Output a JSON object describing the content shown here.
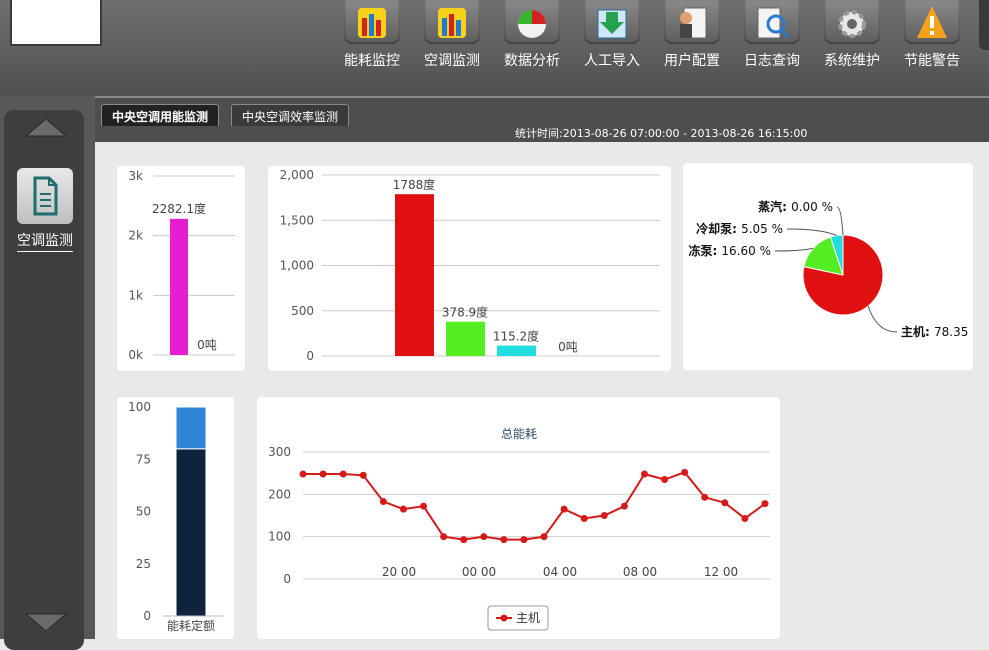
{
  "nav": {
    "items": [
      {
        "label": "能耗监控",
        "icon": "energy-monitor-chart-icon"
      },
      {
        "label": "空调监测",
        "icon": "ac-monitor-chart-icon"
      },
      {
        "label": "数据分析",
        "icon": "pie-analysis-icon"
      },
      {
        "label": "人工导入",
        "icon": "import-arrow-icon"
      },
      {
        "label": "用户配置",
        "icon": "user-config-icon"
      },
      {
        "label": "日志查询",
        "icon": "log-search-icon"
      },
      {
        "label": "系统维护",
        "icon": "gear-icon"
      },
      {
        "label": "节能警告",
        "icon": "warning-icon"
      }
    ]
  },
  "sidebar": {
    "item_label": "空调监测"
  },
  "tabs": [
    {
      "label": "中央空调用能监测",
      "active": true
    },
    {
      "label": "中央空调效率监测",
      "active": false
    }
  ],
  "stat_time": "统计时间:2013-08-26 07:00:00 - 2013-08-26 16:15:00",
  "chart_data": [
    {
      "type": "bar",
      "categories": [
        "",
        ""
      ],
      "values": [
        2282.1,
        0
      ],
      "value_labels": [
        "2282.1度",
        "0吨"
      ],
      "colors": [
        "#e61ed2",
        "#e61ed2"
      ],
      "yticks": [
        "0k",
        "1k",
        "2k",
        "3k"
      ],
      "ylim": [
        0,
        3000
      ]
    },
    {
      "type": "bar",
      "categories": [
        "",
        "",
        "",
        ""
      ],
      "values": [
        1788,
        378.9,
        115.2,
        0
      ],
      "value_labels": [
        "1788度",
        "378.9度",
        "115.2度",
        "0吨"
      ],
      "colors": [
        "#e01010",
        "#55ee22",
        "#22dde0",
        "#2060ff"
      ],
      "yticks": [
        "0",
        "500",
        "1,000",
        "1,500",
        "2,000"
      ],
      "ylim": [
        0,
        2000
      ]
    },
    {
      "type": "pie",
      "slices": [
        {
          "name": "主机",
          "value": 78.35,
          "label": "78.35",
          "color": "#e01010"
        },
        {
          "name": "冷冻泵",
          "value": 16.6,
          "label": "16.60 %",
          "visible_name": "冻泵",
          "color": "#55ee22"
        },
        {
          "name": "冷却泵",
          "value": 5.05,
          "label": "5.05 %",
          "color": "#22dde0"
        },
        {
          "name": "蒸汽",
          "value": 0.0,
          "label": "0.00 %",
          "color": "#2060ff"
        }
      ]
    },
    {
      "type": "bar",
      "stacked": true,
      "categories": [
        "能耗定额"
      ],
      "series": [
        {
          "values": [
            80
          ],
          "color": "#10233c"
        },
        {
          "values": [
            20
          ],
          "color": "#2f86d8"
        }
      ],
      "yticks": [
        "0",
        "25",
        "50",
        "75",
        "100"
      ],
      "ylim": [
        0,
        100
      ]
    },
    {
      "type": "line",
      "title": "总能耗",
      "xticks": [
        "20 00",
        "00 00",
        "04 00",
        "08 00",
        "12 00"
      ],
      "yticks": [
        "0",
        "100",
        "200",
        "300"
      ],
      "ylim": [
        0,
        300
      ],
      "series": [
        {
          "name": "主机",
          "color": "#d61a1a",
          "values": [
            248,
            248,
            248,
            245,
            183,
            165,
            172,
            100,
            93,
            100,
            93,
            93,
            100,
            165,
            143,
            150,
            172,
            248,
            235,
            252,
            193,
            180,
            143,
            178
          ]
        }
      ]
    }
  ]
}
